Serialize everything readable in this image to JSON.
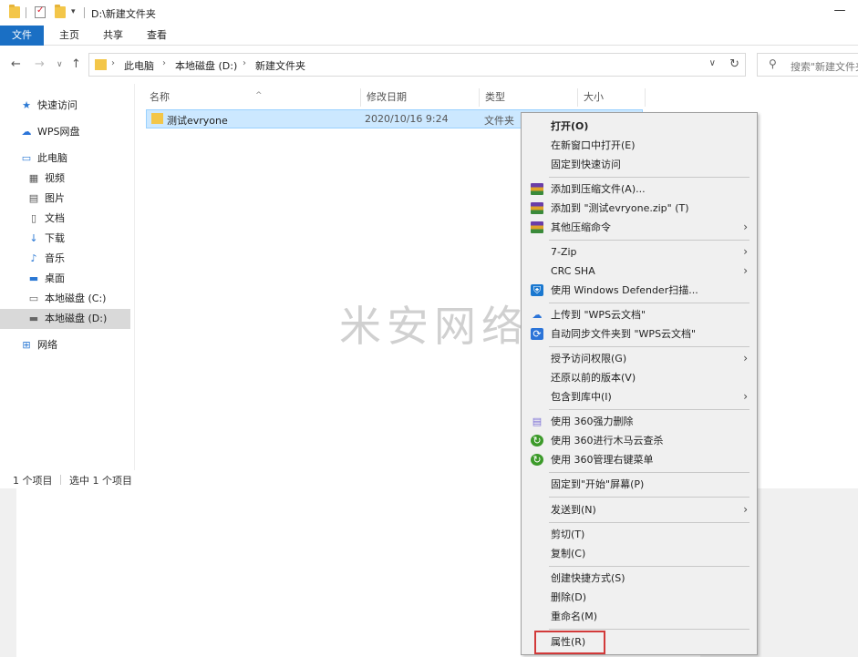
{
  "window": {
    "title": "D:\\新建文件夹",
    "minimize_glyph": "—"
  },
  "ribbon": {
    "tabs": [
      "文件",
      "主页",
      "共享",
      "查看"
    ]
  },
  "address": {
    "crumbs": [
      "此电脑",
      "本地磁盘 (D:)",
      "新建文件夹"
    ],
    "search_placeholder": "搜索\"新建文件夹\""
  },
  "nav": {
    "items": [
      {
        "label": "快速访问",
        "icon": "star-icon"
      },
      {
        "label": "WPS网盘",
        "icon": "cloud-icon"
      },
      {
        "label": "此电脑",
        "icon": "computer-icon"
      },
      {
        "label": "视频",
        "icon": "video-icon"
      },
      {
        "label": "图片",
        "icon": "picture-icon"
      },
      {
        "label": "文档",
        "icon": "document-icon"
      },
      {
        "label": "下载",
        "icon": "download-icon"
      },
      {
        "label": "音乐",
        "icon": "music-icon"
      },
      {
        "label": "桌面",
        "icon": "desktop-icon"
      },
      {
        "label": "本地磁盘 (C:)",
        "icon": "drive-icon"
      },
      {
        "label": "本地磁盘 (D:)",
        "icon": "drive-icon"
      },
      {
        "label": "网络",
        "icon": "network-icon"
      }
    ]
  },
  "columns": [
    "名称",
    "修改日期",
    "类型",
    "大小"
  ],
  "files": [
    {
      "name": "测试evryone",
      "date": "2020/10/16 9:24",
      "type": "文件夹"
    }
  ],
  "watermark": "米安网络",
  "status": {
    "count": "1 个项目",
    "selected": "选中 1 个项目"
  },
  "context_menu": {
    "items": [
      {
        "label": "打开(O)"
      },
      {
        "label": "在新窗口中打开(E)"
      },
      {
        "label": "固定到快速访问"
      },
      {
        "label": "添加到压缩文件(A)..."
      },
      {
        "label": "添加到 \"测试evryone.zip\" (T)"
      },
      {
        "label": "其他压缩命令"
      },
      {
        "label": "7-Zip"
      },
      {
        "label": "CRC SHA"
      },
      {
        "label": "使用 Windows Defender扫描..."
      },
      {
        "label": "上传到 \"WPS云文档\""
      },
      {
        "label": "自动同步文件夹到 \"WPS云文档\""
      },
      {
        "label": "授予访问权限(G)"
      },
      {
        "label": "还原以前的版本(V)"
      },
      {
        "label": "包含到库中(I)"
      },
      {
        "label": "使用 360强力删除"
      },
      {
        "label": "使用 360进行木马云查杀"
      },
      {
        "label": "使用 360管理右键菜单"
      },
      {
        "label": "固定到\"开始\"屏幕(P)"
      },
      {
        "label": "发送到(N)"
      },
      {
        "label": "剪切(T)"
      },
      {
        "label": "复制(C)"
      },
      {
        "label": "创建快捷方式(S)"
      },
      {
        "label": "删除(D)"
      },
      {
        "label": "重命名(M)"
      },
      {
        "label": "属性(R)"
      }
    ]
  },
  "colors": {
    "accent": "#1a6fc4",
    "selection": "#cce8ff",
    "highlight_box": "#d23a3a"
  }
}
